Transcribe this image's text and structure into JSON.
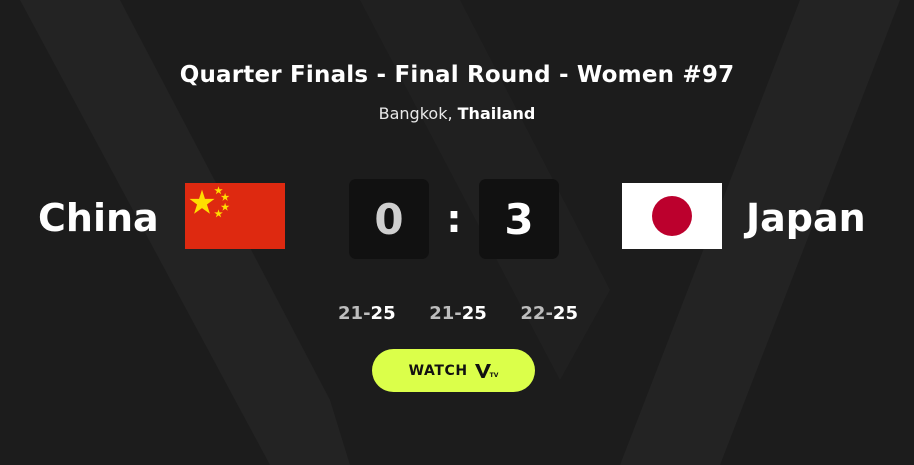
{
  "match": {
    "title": "Quarter Finals - Final Round - Women #97",
    "city": "Bangkok,",
    "country": "Thailand"
  },
  "home": {
    "name": "China",
    "score": "0",
    "flag": "china-flag"
  },
  "away": {
    "name": "Japan",
    "score": "3",
    "flag": "japan-flag"
  },
  "score_separator": ":",
  "sets": [
    {
      "home": "21",
      "away": "25"
    },
    {
      "home": "21",
      "away": "25"
    },
    {
      "home": "22",
      "away": "25"
    }
  ],
  "set_dash": "-",
  "watch": {
    "label": "WATCH",
    "logo_text": "TV",
    "logo_icon": "vnl-tv-logo-icon"
  },
  "colors": {
    "background": "#1c1c1c",
    "score_box": "#111111",
    "watch_button": "#dbff4a",
    "china_red": "#de2910",
    "china_yellow": "#ffde00",
    "japan_red": "#bc002d"
  }
}
